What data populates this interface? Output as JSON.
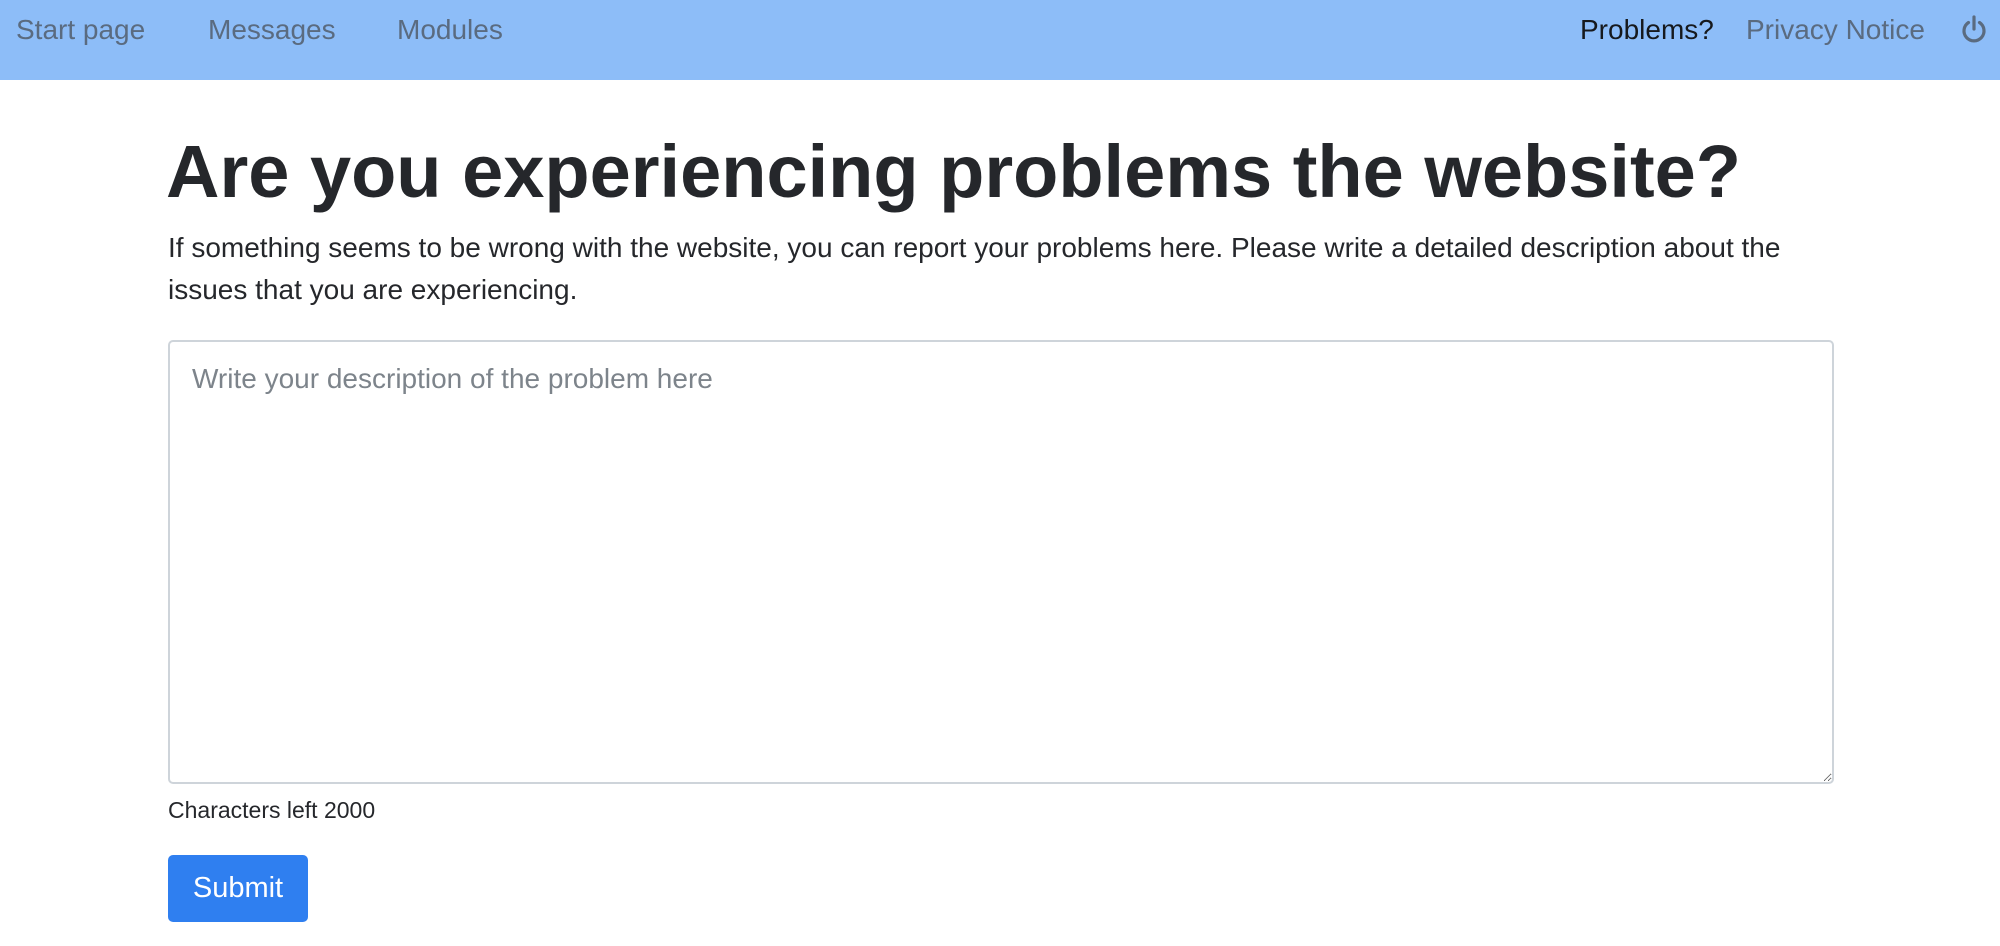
{
  "nav": {
    "left_items": [
      {
        "label": "Start page"
      },
      {
        "label": "Messages"
      },
      {
        "label": "Modules"
      }
    ],
    "right_items": [
      {
        "label": "Problems?",
        "active": true
      },
      {
        "label": "Privacy Notice"
      }
    ],
    "logout_icon": "power-icon",
    "background_color": "#8dbdf8"
  },
  "main": {
    "title": "Are you experiencing problems the website?",
    "intro": "If something seems to be wrong with the website, you can report your problems here. Please write a detailed description about the issues that you are experiencing.",
    "textarea": {
      "value": "",
      "placeholder": "Write your description of the problem here"
    },
    "characters_left": "Characters left 2000",
    "submit_label": "Submit",
    "submit_color": "#2f7ff0"
  }
}
